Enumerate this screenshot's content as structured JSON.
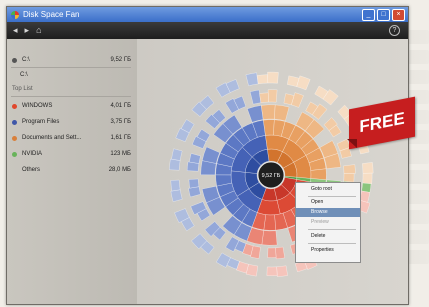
{
  "window": {
    "title": "Disk Space Fan"
  },
  "toolbar": {
    "back_icon": "back-icon",
    "forward_icon": "forward-icon",
    "home_icon": "home-icon",
    "help_icon": "help-icon"
  },
  "sidebar": {
    "drive": {
      "label": "C:\\",
      "value": "9,52 ГБ"
    },
    "path": "C:\\",
    "top_list_label": "Top List",
    "items": [
      {
        "label": "WINDOWS",
        "value": "4,01 ГБ",
        "color": "#e0472c"
      },
      {
        "label": "Program Files",
        "value": "3,75 ГБ",
        "color": "#3f57a8"
      },
      {
        "label": "Documents and Sett...",
        "value": "1,61 ГБ",
        "color": "#d9803b"
      },
      {
        "label": "NVIDIA",
        "value": "123 МБ",
        "color": "#68b35a"
      },
      {
        "label": "Others",
        "value": "28,0 МБ",
        "color": ""
      }
    ]
  },
  "chart_center_label": "9,52 ГБ",
  "context_menu": {
    "items": [
      {
        "label": "Goto root",
        "state": "normal"
      },
      {
        "label": "Open",
        "state": "normal"
      },
      {
        "label": "Browse",
        "state": "highlighted"
      },
      {
        "label": "Preview",
        "state": "disabled"
      },
      {
        "label": "Delete",
        "state": "normal"
      },
      {
        "label": "Properties",
        "state": "normal"
      }
    ]
  },
  "badge": {
    "text": "FREE"
  }
}
